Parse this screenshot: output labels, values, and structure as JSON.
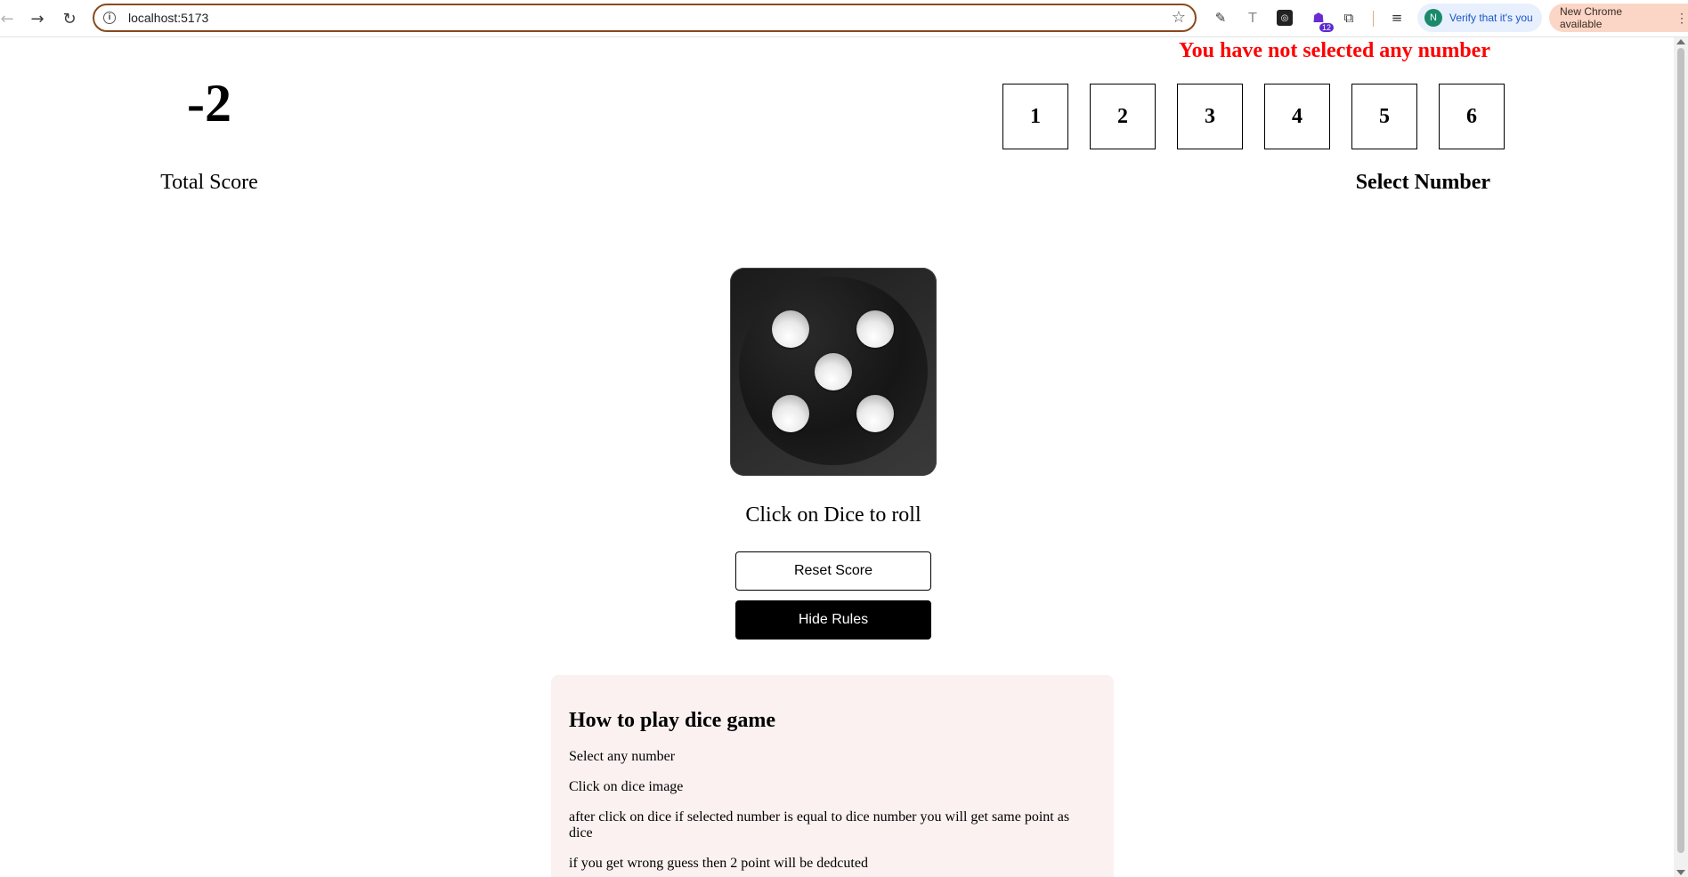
{
  "browser": {
    "url": "localhost:5173",
    "verify_text": "Verify that it's you",
    "avatar_letter": "N",
    "update_text": "New Chrome available",
    "extension_badge": "12"
  },
  "score": {
    "value": "-2",
    "label": "Total Score"
  },
  "selector": {
    "error": "You have not selected any number",
    "numbers": [
      "1",
      "2",
      "3",
      "4",
      "5",
      "6"
    ],
    "label": "Select Number"
  },
  "dice": {
    "current_face": 5,
    "hint": "Click on Dice to roll"
  },
  "buttons": {
    "reset": "Reset Score",
    "rules_toggle": "Hide Rules"
  },
  "rules": {
    "title": "How to play dice game",
    "items": [
      "Select any number",
      "Click on dice image",
      "after click on dice if selected number is equal to dice number you will get same point as dice",
      "if you get wrong guess then 2 point will be dedcuted"
    ]
  },
  "colors": {
    "error": "#ff0000",
    "rules_bg": "#fbf1f1",
    "primary": "#000000"
  }
}
